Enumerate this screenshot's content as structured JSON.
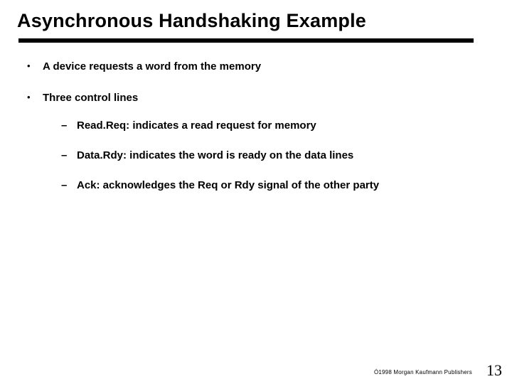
{
  "title": "Asynchronous Handshaking Example",
  "bullets": [
    {
      "text": "A device requests a word from the memory"
    },
    {
      "text": "Three control lines",
      "sub": [
        "Read.Req: indicates a read request for memory",
        "Data.Rdy: indicates the word is ready on the data lines",
        "Ack: acknowledges the Req or Rdy signal of the other party"
      ]
    }
  ],
  "footer": {
    "copyright": "Ó1998 Morgan Kaufmann Publishers",
    "page": "13"
  }
}
